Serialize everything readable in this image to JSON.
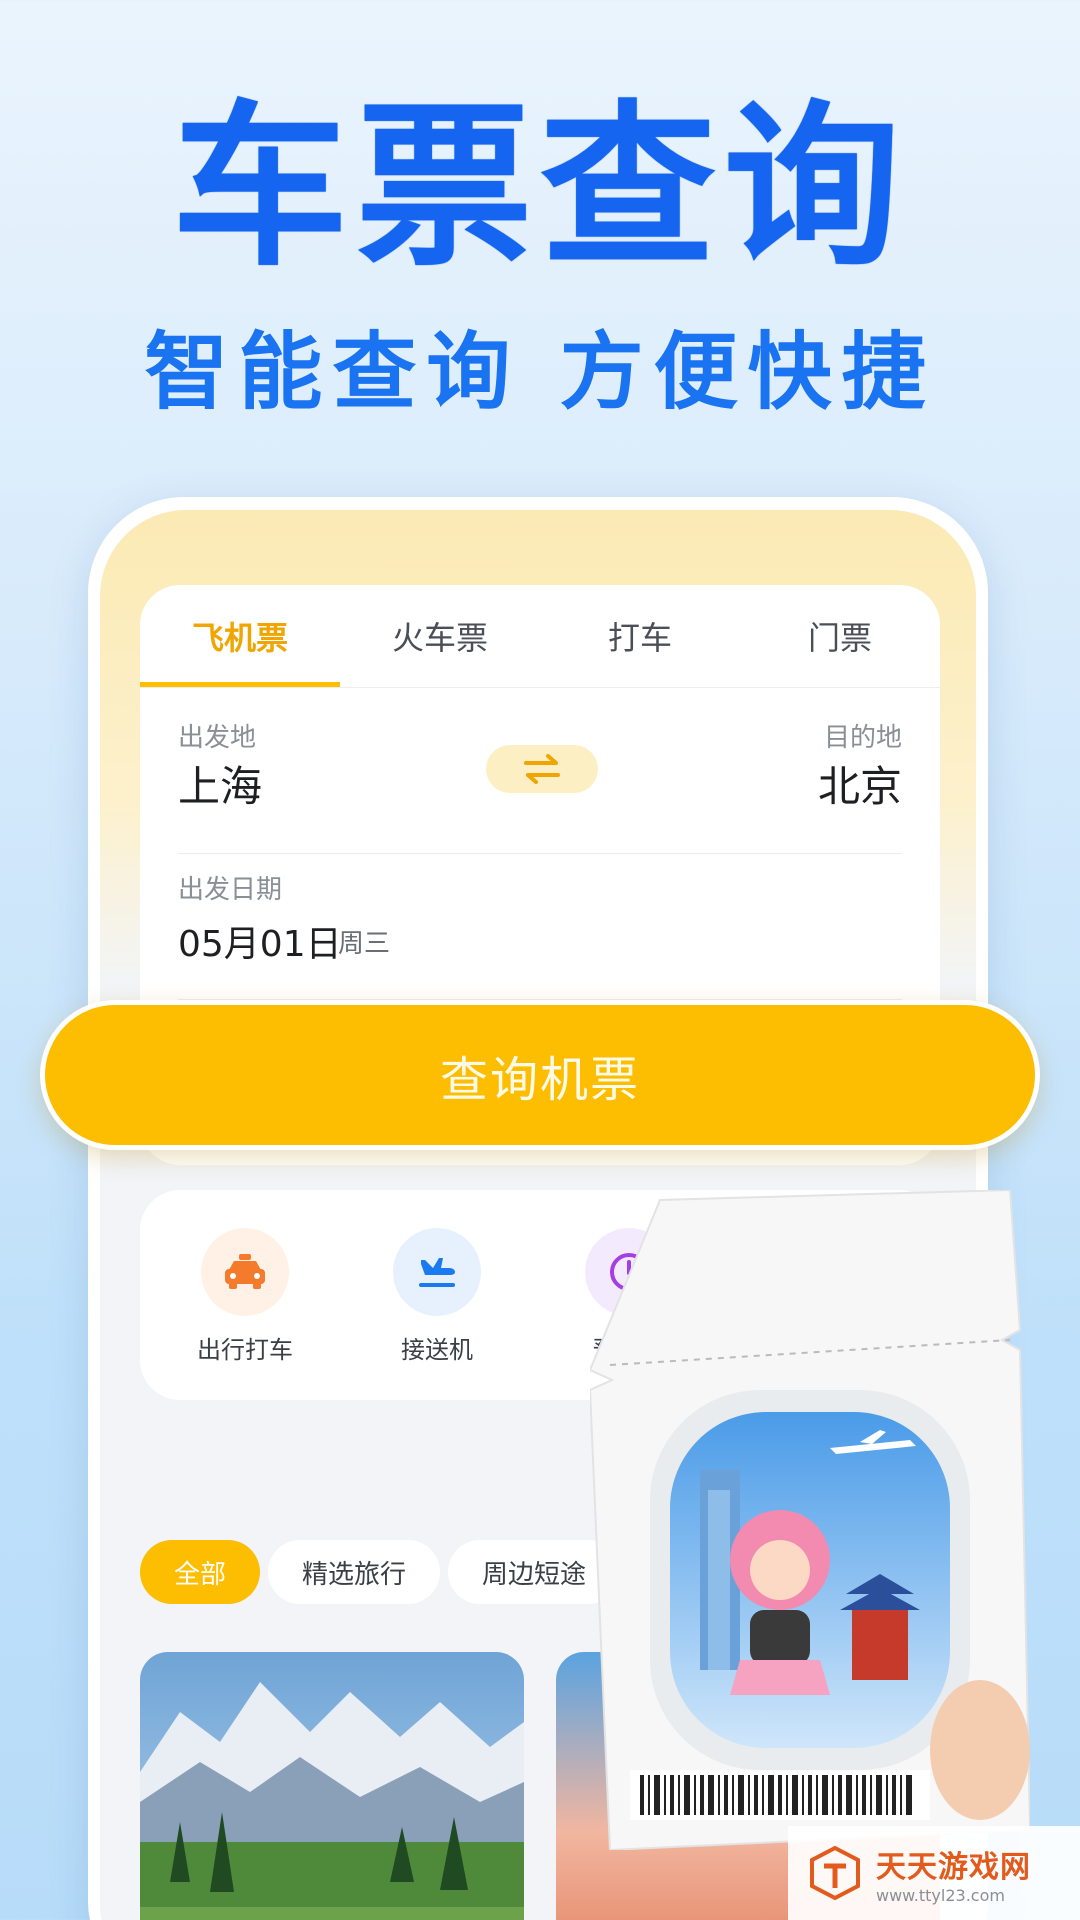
{
  "hero": {
    "title": "车票查询",
    "subtitle": "智能查询 方便快捷"
  },
  "tabs": [
    {
      "label": "飞机票",
      "active": true
    },
    {
      "label": "火车票",
      "active": false
    },
    {
      "label": "打车",
      "active": false
    },
    {
      "label": "门票",
      "active": false
    }
  ],
  "route": {
    "from_label": "出发地",
    "from_city": "上海",
    "to_label": "目的地",
    "to_city": "北京",
    "swap_icon": "swap-arrows-icon"
  },
  "date": {
    "label": "出发日期",
    "value": "05月01日",
    "weekday": "周三"
  },
  "search_button": "查询机票",
  "services": [
    {
      "label": "出行打车",
      "icon": "taxi-icon"
    },
    {
      "label": "接送机",
      "icon": "plane-landing-icon"
    },
    {
      "label": "预约用",
      "icon": "clock-icon"
    }
  ],
  "chips": [
    {
      "label": "全部",
      "active": true
    },
    {
      "label": "精选旅行",
      "active": false
    },
    {
      "label": "周边短途",
      "active": false
    }
  ],
  "watermark": {
    "name": "天天游戏网",
    "url": "www.ttyl23.com"
  },
  "colors": {
    "brand_blue": "#1565f0",
    "accent_yellow": "#fdbd00",
    "tab_active": "#f0a500"
  }
}
